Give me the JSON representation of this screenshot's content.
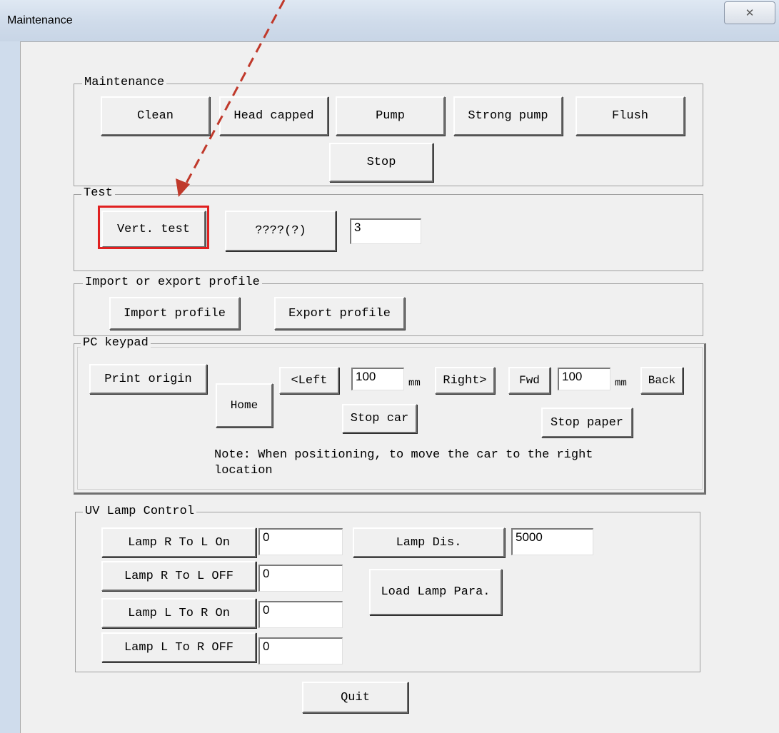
{
  "window": {
    "title": "Maintenance",
    "close_glyph": "✕"
  },
  "maintenance": {
    "label": "Maintenance",
    "clean": "Clean",
    "head_capped": "Head capped",
    "pump": "Pump",
    "strong_pump": "Strong pump",
    "flush": "Flush",
    "stop": "Stop"
  },
  "test": {
    "label": "Test",
    "vert_test": "Vert. test",
    "unknown_button": "????(?)",
    "value": "3"
  },
  "profile": {
    "label": "Import or export profile",
    "import": "Import profile",
    "export": "Export profile"
  },
  "keypad": {
    "label": "PC keypad",
    "print_origin": "Print origin",
    "home": "Home",
    "left": "<Left",
    "left_value": "100",
    "unit1": "mm",
    "right": "Right>",
    "fwd": "Fwd",
    "fwd_value": "100",
    "unit2": "mm",
    "back": "Back",
    "stop_car": "Stop car",
    "stop_paper": "Stop paper",
    "note_line1": "Note: When positioning, to move the car to the right",
    "note_line2": "location"
  },
  "uv": {
    "label": "UV Lamp Control",
    "r_to_l_on": "Lamp R To L On",
    "r_to_l_on_value": "0",
    "r_to_l_off": "Lamp R To L OFF",
    "r_to_l_off_value": "0",
    "l_to_r_on": "Lamp L To R On",
    "l_to_r_on_value": "0",
    "l_to_r_off": "Lamp L To R OFF",
    "l_to_r_off_value": "0",
    "lamp_dis": "Lamp Dis.",
    "lamp_dis_value": "5000",
    "load_lamp_para": "Load Lamp Para."
  },
  "quit": "Quit",
  "colors": {
    "highlight": "#e02020",
    "arrow": "#c0392b"
  }
}
